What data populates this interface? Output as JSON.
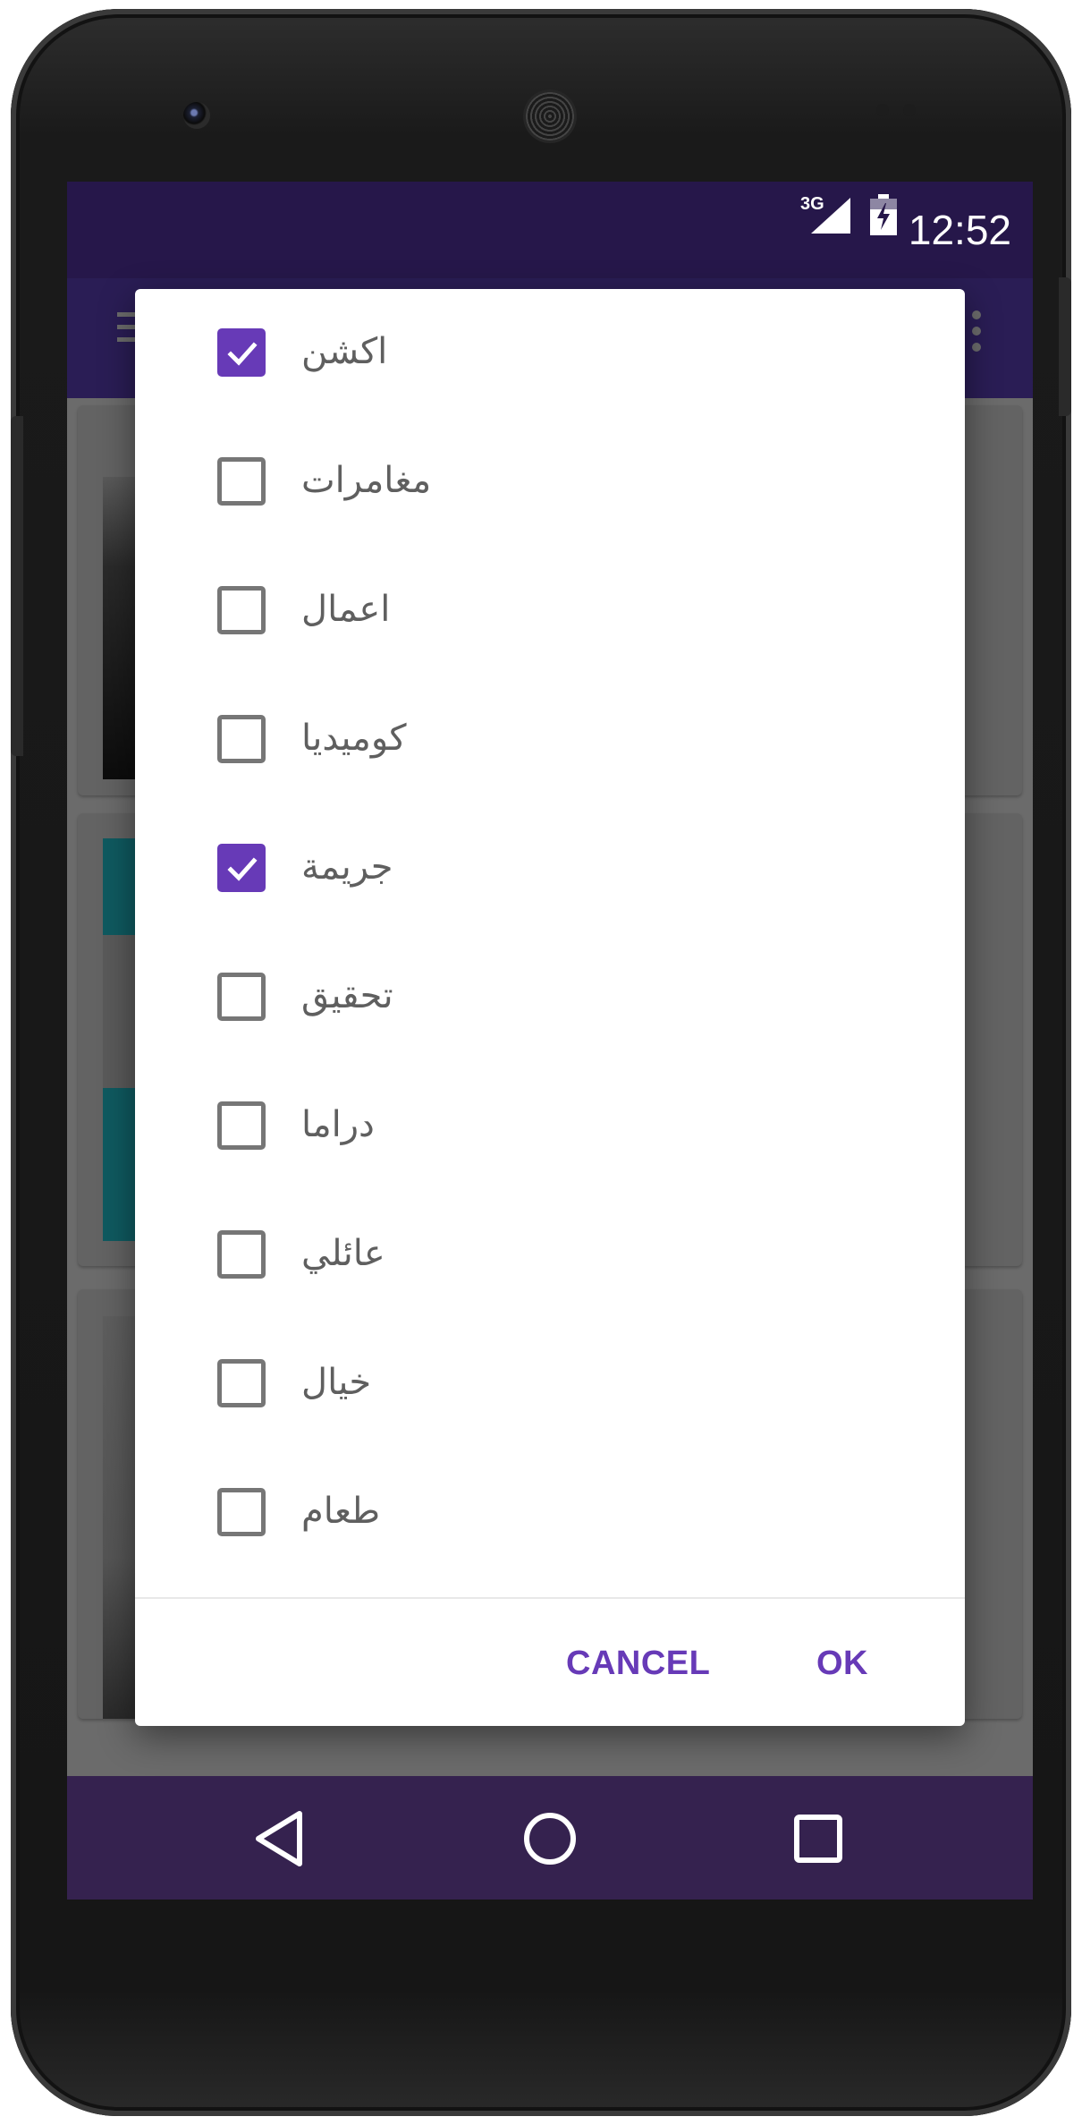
{
  "status_bar": {
    "network": "3G",
    "time": "12:52"
  },
  "dialog": {
    "options": [
      {
        "label": "اكشن",
        "checked": true
      },
      {
        "label": "مغامرات",
        "checked": false
      },
      {
        "label": "اعمال",
        "checked": false
      },
      {
        "label": "كوميديا",
        "checked": false
      },
      {
        "label": "جريمة",
        "checked": true
      },
      {
        "label": "تحقيق",
        "checked": false
      },
      {
        "label": "دراما",
        "checked": false
      },
      {
        "label": "عائلي",
        "checked": false
      },
      {
        "label": "خيال",
        "checked": false
      },
      {
        "label": "طعام",
        "checked": false
      }
    ],
    "cancel_label": "CANCEL",
    "ok_label": "OK"
  },
  "colors": {
    "accent": "#673ab7",
    "status_bar": "#26174a",
    "app_bar": "#2a1d55",
    "nav_bar": "#35224f"
  },
  "icons": {
    "menu": "hamburger-menu-icon",
    "overflow": "more-vert-icon",
    "back": "nav-back-icon",
    "home": "nav-home-icon",
    "recents": "nav-recents-icon"
  }
}
